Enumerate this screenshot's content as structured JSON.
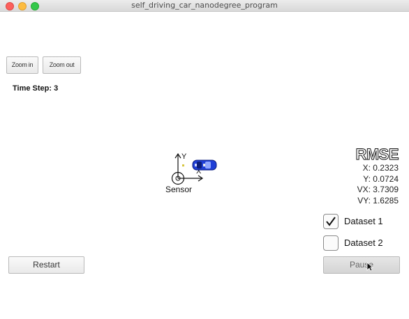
{
  "window": {
    "title": "self_driving_car_nanodegree_program"
  },
  "toolbar": {
    "zoom_in_label": "Zoom in",
    "zoom_out_label": "Zoom out"
  },
  "status": {
    "time_step_label": "Time Step:",
    "time_step_value": "3"
  },
  "scene": {
    "sensor_label": "Sensor",
    "axis_y_label": "Y",
    "axis_x_label": "X",
    "car_color": "#1f3fd6"
  },
  "rmse": {
    "title": "RMSE",
    "rows": [
      {
        "label": "X:",
        "value": "0.2323"
      },
      {
        "label": "Y:",
        "value": "0.0724"
      },
      {
        "label": "VX:",
        "value": "3.7309"
      },
      {
        "label": "VY:",
        "value": "1.6285"
      }
    ]
  },
  "datasets": [
    {
      "label": "Dataset 1",
      "checked": true
    },
    {
      "label": "Dataset 2",
      "checked": false
    }
  ],
  "controls": {
    "restart_label": "Restart",
    "pause_label": "Pause"
  },
  "colors": {
    "close": "#fc605c",
    "minimize": "#fdbc40",
    "maximize": "#34c84a"
  }
}
